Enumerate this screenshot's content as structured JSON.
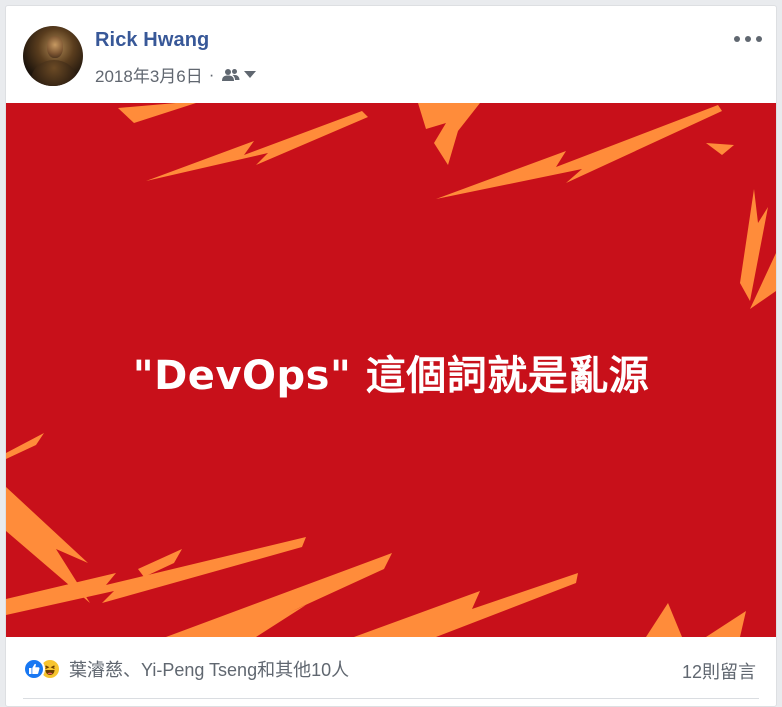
{
  "post": {
    "author": "Rick Hwang",
    "date": "2018年3月6日",
    "separator": "·",
    "audience_icon": "friends-icon",
    "more_icon": "more-options-icon"
  },
  "banner": {
    "headline": "\"DevOps\" 這個詞就是亂源",
    "background_color": "#c8101a",
    "bolt_color": "#ff8c3a"
  },
  "footer": {
    "reaction_icons": [
      "like-icon",
      "haha-icon"
    ],
    "reactions_text": "葉濬慈、Yi-Peng Tseng和其他10人",
    "comments_text": "12則留言"
  }
}
